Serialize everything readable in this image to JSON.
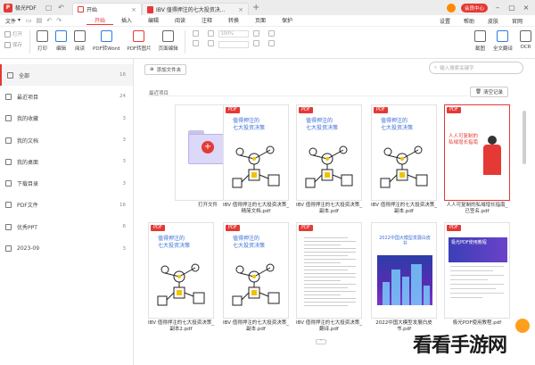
{
  "titlebar": {
    "app_name": "极光PDF",
    "tabs": [
      {
        "label": "开始",
        "active": true
      },
      {
        "label": "IBV 值得押注的七大投资决...",
        "active": false
      }
    ],
    "vip_label": "会员中心"
  },
  "menubar": {
    "file_label": "文件",
    "items": [
      "开始",
      "插入",
      "编辑",
      "阅读",
      "注释",
      "转换",
      "页面",
      "保护"
    ],
    "active_item": "开始",
    "right_items": [
      "设置",
      "帮助",
      "皮肤",
      "官网"
    ]
  },
  "toolbar": {
    "left_minis": [
      "打开",
      "保存"
    ],
    "big_tools": [
      "打印",
      "编辑",
      "阅读",
      "PDF转Word",
      "PDF转图片",
      "页面编辑"
    ],
    "right_tools": [
      "截图",
      "全文翻译",
      "OCR"
    ],
    "zoom_placeholder": "100%"
  },
  "sidebar": {
    "items": [
      {
        "label": "全部",
        "count": "16",
        "active": true
      },
      {
        "label": "最近项目",
        "count": "24"
      },
      {
        "label": "我的收藏",
        "count": "3"
      },
      {
        "label": "我的文档",
        "count": "3"
      },
      {
        "label": "我的桌面",
        "count": "3"
      },
      {
        "label": "下载目录",
        "count": "3"
      },
      {
        "label": "PDF文件",
        "count": "16"
      },
      {
        "label": "优秀PPT",
        "count": "6"
      },
      {
        "label": "2023-09",
        "count": "3"
      }
    ]
  },
  "main": {
    "add_file_label": "添加文件夹",
    "search_placeholder": "输入搜索关键字",
    "section_title": "最近项目",
    "clear_label": "清空记录",
    "open_file_label": "打开文件",
    "pdf_tag": "PDF",
    "ibv_title_line1": "值得押注的",
    "ibv_title_line2": "七大投资决策",
    "city_head": "2022中国大模型发展白皮书",
    "ad_text": "人人可复制的私域增长指南",
    "manual_text": "极光PDF使用教程",
    "cards_row1": [
      {
        "name": "打开文件"
      },
      {
        "name": "IBV 值得押注的七大投资决策_精简文档.pdf"
      },
      {
        "name": "IBV 值得押注的七大投资决策_副本.pdf"
      },
      {
        "name": "IBV 值得押注的七大投资决策_副本.pdf"
      },
      {
        "name": "人人可复制的私域增长指南_已签名.pdf"
      }
    ],
    "cards_row2": [
      {
        "name": "IBV 值得押注的七大投资决策_副本2.pdf"
      },
      {
        "name": "IBV 值得押注的七大投资决策_副本.pdf"
      },
      {
        "name": "IBV 值得押注的七大投资决策_翻译.pdf"
      },
      {
        "name": "2022中国大模型发展白皮书.pdf"
      },
      {
        "name": "极光PDF使用教程.pdf"
      }
    ]
  },
  "watermark": "看看手游网",
  "colors": {
    "accent": "#e53935",
    "title_blue": "#3b6fd4"
  }
}
